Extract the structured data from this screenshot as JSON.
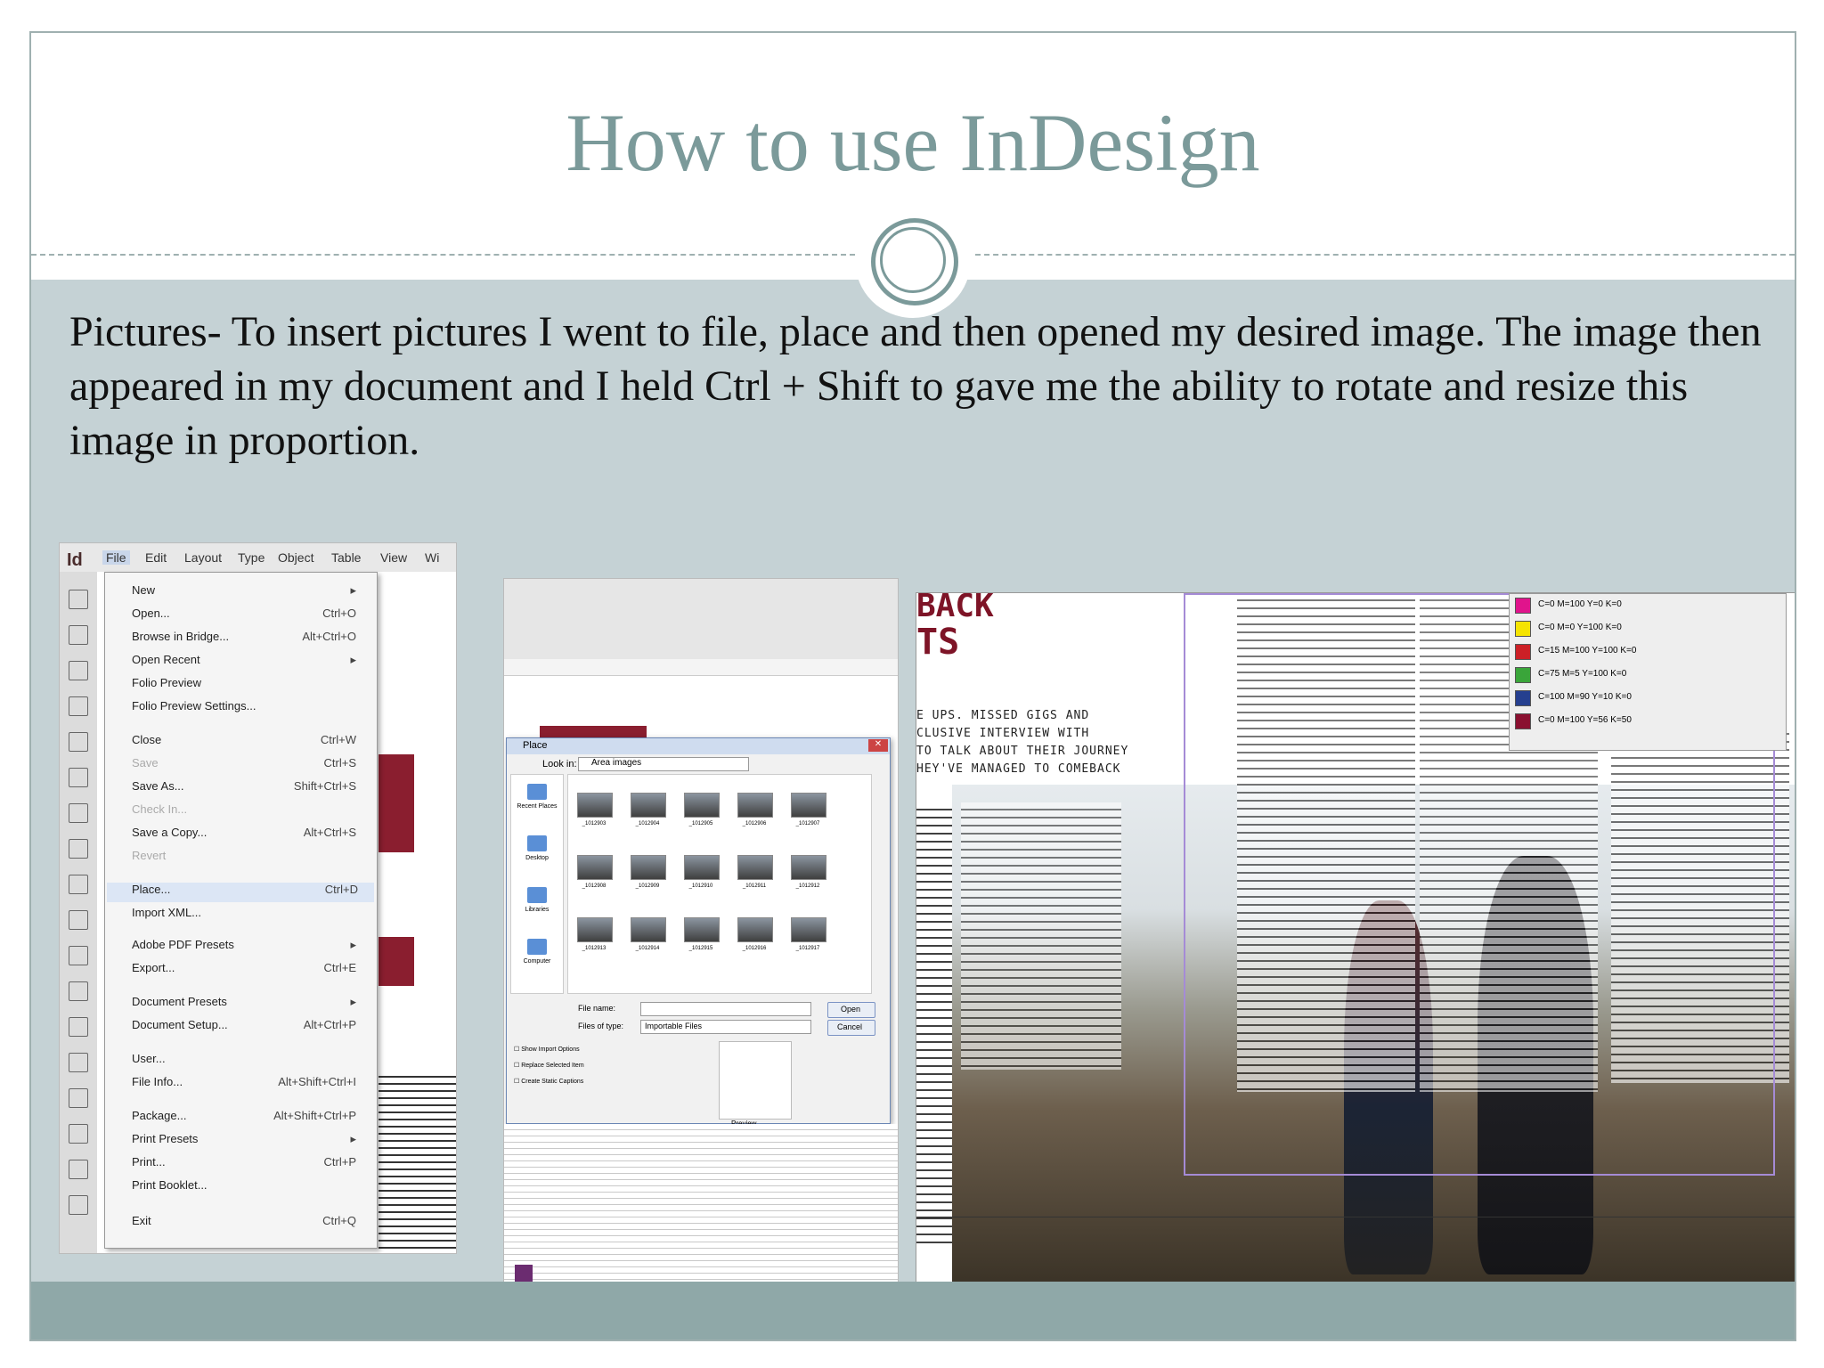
{
  "slide": {
    "title": "How to use InDesign",
    "body": "Pictures- To insert pictures I went to file, place and then opened my desired image. The image then appeared in my document and I held Ctrl + Shift to gave me the ability to rotate and resize this image in proportion."
  },
  "indesign": {
    "logo": "Id",
    "menubar": [
      "File",
      "Edit",
      "Layout",
      "Type",
      "Object",
      "Table",
      "View",
      "Wi"
    ],
    "file_menu": [
      {
        "label": "New",
        "key": "▸"
      },
      {
        "label": "Open...",
        "key": "Ctrl+O"
      },
      {
        "label": "Browse in Bridge...",
        "key": "Alt+Ctrl+O"
      },
      {
        "label": "Open Recent",
        "key": "▸"
      },
      {
        "label": "Folio Preview",
        "key": ""
      },
      {
        "label": "Folio Preview Settings...",
        "key": ""
      },
      {
        "label": "Close",
        "key": "Ctrl+W"
      },
      {
        "label": "Save",
        "key": "Ctrl+S"
      },
      {
        "label": "Save As...",
        "key": "Shift+Ctrl+S"
      },
      {
        "label": "Check In...",
        "key": ""
      },
      {
        "label": "Save a Copy...",
        "key": "Alt+Ctrl+S"
      },
      {
        "label": "Revert",
        "key": ""
      },
      {
        "label": "Place...",
        "key": "Ctrl+D"
      },
      {
        "label": "Import XML...",
        "key": ""
      },
      {
        "label": "Adobe PDF Presets",
        "key": "▸"
      },
      {
        "label": "Export...",
        "key": "Ctrl+E"
      },
      {
        "label": "Document Presets",
        "key": "▸"
      },
      {
        "label": "Document Setup...",
        "key": "Alt+Ctrl+P"
      },
      {
        "label": "User...",
        "key": ""
      },
      {
        "label": "File Info...",
        "key": "Alt+Shift+Ctrl+I"
      },
      {
        "label": "Package...",
        "key": "Alt+Shift+Ctrl+P"
      },
      {
        "label": "Print Presets",
        "key": "▸"
      },
      {
        "label": "Print...",
        "key": "Ctrl+P"
      },
      {
        "label": "Print Booklet...",
        "key": ""
      },
      {
        "label": "Exit",
        "key": "Ctrl+Q"
      }
    ]
  },
  "place_dialog": {
    "title": "Place",
    "look_in_label": "Look in:",
    "look_in_value": "Area images",
    "sidebar": [
      "Recent Places",
      "Desktop",
      "Libraries",
      "Computer"
    ],
    "files": [
      "_1012903",
      "_1012904",
      "_1012905",
      "_1012906",
      "_1012907",
      "_1012908",
      "_1012909",
      "_1012910",
      "_1012911",
      "_1012912",
      "_1012913",
      "_1012914",
      "_1012915",
      "_1012916",
      "_1012917"
    ],
    "file_name_label": "File name:",
    "file_type_label": "Files of type:",
    "file_type_value": "Importable Files",
    "open_button": "Open",
    "cancel_button": "Cancel",
    "options": [
      "Show Import Options",
      "Replace Selected Item",
      "Create Static Captions"
    ],
    "preview_label": "Preview"
  },
  "layout": {
    "headline": "BACK",
    "headline2": "TS",
    "intro_lines": [
      "E UPS.  MISSED GIGS AND",
      "CLUSIVE INTERVIEW WITH",
      " TO TALK ABOUT THEIR JOURNEY",
      "HEY'VE MANAGED TO COMEBACK"
    ],
    "swatches": [
      {
        "label": "C=0 M=100 Y=0 K=0",
        "color": "#e0148c"
      },
      {
        "label": "C=0 M=0 Y=100 K=0",
        "color": "#f5e400"
      },
      {
        "label": "C=15 M=100 Y=100 K=0",
        "color": "#cc2026"
      },
      {
        "label": "C=75 M=5 Y=100 K=0",
        "color": "#3aa53a"
      },
      {
        "label": "C=100 M=90 Y=10 K=0",
        "color": "#253f8f"
      },
      {
        "label": "C=0 M=100 Y=56 K=50",
        "color": "#8a1030"
      }
    ]
  },
  "colors": {
    "accent": "#7b9a9a",
    "band": "#c5d2d5",
    "footer": "#8fa8a8"
  }
}
